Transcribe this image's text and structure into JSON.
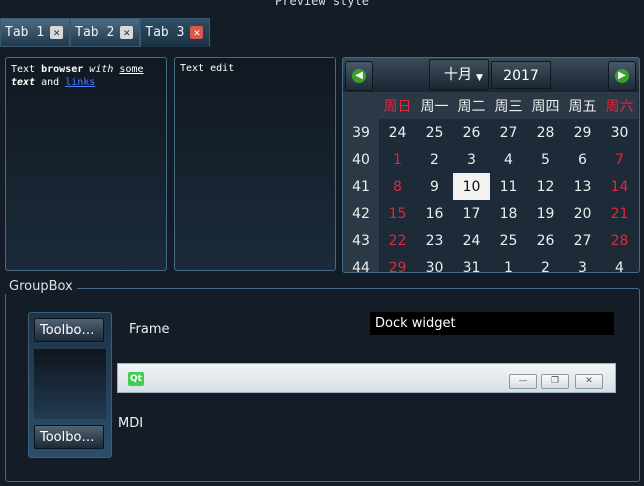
{
  "window": {
    "title": "Preview style"
  },
  "tabs": [
    {
      "label": "Tab 1",
      "close": "✕"
    },
    {
      "label": "Tab 2",
      "close": "✕"
    },
    {
      "label": "Tab 3",
      "close": "✕"
    }
  ],
  "text_browser": {
    "t1": "Text ",
    "t2": "browser",
    "t3": " ",
    "t4": "with",
    "t5": " ",
    "t6": "some",
    "t7": "text",
    "t8": " and ",
    "t9": "links"
  },
  "text_edit": {
    "content": "Text edit"
  },
  "calendar": {
    "month": "十月",
    "year": "2017",
    "headers": [
      "周日",
      "周一",
      "周二",
      "周三",
      "周四",
      "周五",
      "周六"
    ],
    "weeks": [
      {
        "wk": "39",
        "days": [
          "24",
          "25",
          "26",
          "27",
          "28",
          "29",
          "30"
        ]
      },
      {
        "wk": "40",
        "days": [
          "1",
          "2",
          "3",
          "4",
          "5",
          "6",
          "7"
        ]
      },
      {
        "wk": "41",
        "days": [
          "8",
          "9",
          "10",
          "11",
          "12",
          "13",
          "14"
        ]
      },
      {
        "wk": "42",
        "days": [
          "15",
          "16",
          "17",
          "18",
          "19",
          "20",
          "21"
        ]
      },
      {
        "wk": "43",
        "days": [
          "22",
          "23",
          "24",
          "25",
          "26",
          "27",
          "28"
        ]
      },
      {
        "wk": "44",
        "days": [
          "29",
          "30",
          "31",
          "1",
          "2",
          "3",
          "4"
        ]
      }
    ],
    "selected": "10"
  },
  "groupbox": {
    "title": "GroupBox"
  },
  "toolbox": {
    "top_label": "Toolbo…",
    "bottom_label": "Toolbo…"
  },
  "frame_label": "Frame",
  "dock": {
    "title": "Dock widget"
  },
  "mdi": {
    "logo": "Qt",
    "label": "MDI",
    "min": "—",
    "restore": "❐",
    "close": "✕"
  },
  "colors": {
    "accent_red": "#e2263a",
    "qt_green": "#41cd52",
    "nav_green": "#39a02e"
  }
}
